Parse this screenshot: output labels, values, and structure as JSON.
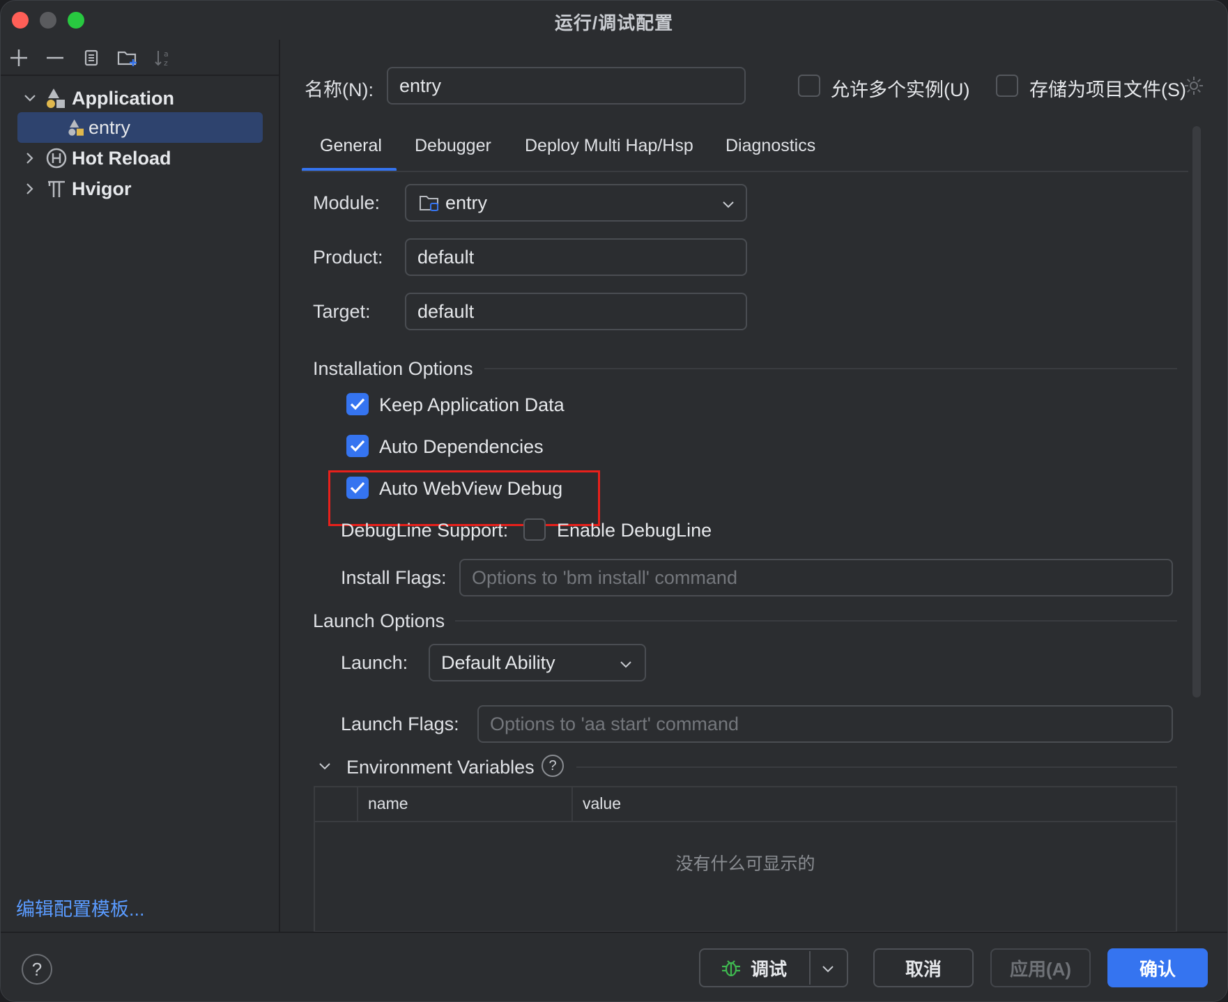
{
  "window": {
    "title": "运行/调试配置"
  },
  "sidebar": {
    "toolbar": {
      "add": "add-icon",
      "remove": "remove-icon",
      "copy": "copy-icon",
      "new_folder": "new-folder-icon",
      "sort": "sort-icon"
    },
    "tree": [
      {
        "label": "Application",
        "expanded": true
      },
      {
        "label": "entry",
        "selected": true
      },
      {
        "label": "Hot Reload",
        "expanded": false
      },
      {
        "label": "Hvigor",
        "expanded": false
      }
    ],
    "edit_templates": "编辑配置模板..."
  },
  "header": {
    "name_label": "名称(N):",
    "name_value": "entry",
    "allow_multiple": "允许多个实例(U)",
    "store_as_file": "存储为项目文件(S)"
  },
  "tabs": [
    "General",
    "Debugger",
    "Deploy Multi Hap/Hsp",
    "Diagnostics"
  ],
  "general": {
    "module_label": "Module:",
    "module_value": "entry",
    "product_label": "Product:",
    "product_value": "default",
    "target_label": "Target:",
    "target_value": "default",
    "installation_title": "Installation Options",
    "keep_app_data": "Keep Application Data",
    "auto_deps": "Auto Dependencies",
    "auto_webview": "Auto WebView Debug",
    "debugline_label": "DebugLine Support:",
    "enable_debugline": "Enable DebugLine",
    "install_flags_label": "Install Flags:",
    "install_flags_placeholder": "Options to 'bm install' command",
    "launch_title": "Launch Options",
    "launch_label": "Launch:",
    "launch_value": "Default Ability",
    "launch_flags_label": "Launch Flags:",
    "launch_flags_placeholder": "Options to 'aa start' command",
    "env_title": "Environment Variables",
    "env_col_name": "name",
    "env_col_value": "value",
    "env_empty": "没有什么可显示的"
  },
  "footer": {
    "help": "?",
    "debug": "调试",
    "cancel": "取消",
    "apply": "应用(A)",
    "ok": "确认"
  },
  "colors": {
    "accent": "#3574f0",
    "highlight": "#e8201b",
    "link": "#5a9bff"
  }
}
